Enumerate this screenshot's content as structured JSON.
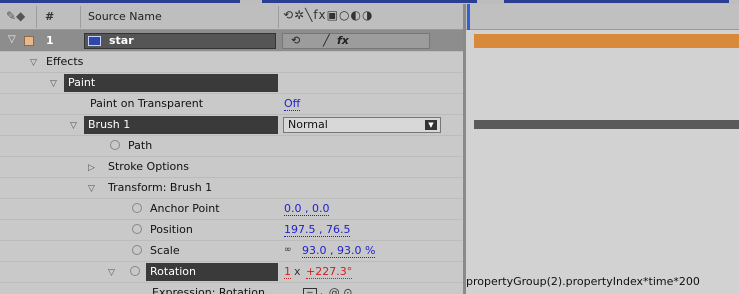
{
  "header": {
    "hash": "#",
    "source_name": "Source Name",
    "switch_icons": "⟲✲╲fx▣○◐◑"
  },
  "layer": {
    "number": "1",
    "name": "star",
    "switches": [
      "⟲",
      "╱",
      "fx"
    ]
  },
  "properties": {
    "effects": "Effects",
    "paint": "Paint",
    "paint_on_transparent_label": "Paint on Transparent",
    "paint_on_transparent_value": "Off",
    "brush": "Brush 1",
    "brush_mode": "Normal",
    "path": "Path",
    "stroke_options": "Stroke Options",
    "transform": "Transform: Brush 1",
    "anchor_point_label": "Anchor Point",
    "anchor_point_value": "0.0 , 0.0",
    "position_label": "Position",
    "position_value": "197.5 , 76.5",
    "scale_label": "Scale",
    "scale_value": "93.0 , 93.0 %",
    "rotation_label": "Rotation",
    "rotation_revolutions": "1",
    "rotation_x": "x",
    "rotation_degrees": "+227.3°",
    "expression_label": "Expression: Rotation",
    "expression_text": "propertyGroup(2).propertyIndex*time*200"
  },
  "colors": {
    "layer_bar": "#d88a3a",
    "value_link": "#2222cc",
    "value_expression": "#cc2222",
    "label_swatch": "#e8b88a"
  },
  "icons": [
    "label-icon",
    "twirl-down-icon",
    "twirl-right-icon",
    "stopwatch-icon",
    "link-icon",
    "graph-icon",
    "pickwhip-icon"
  ]
}
